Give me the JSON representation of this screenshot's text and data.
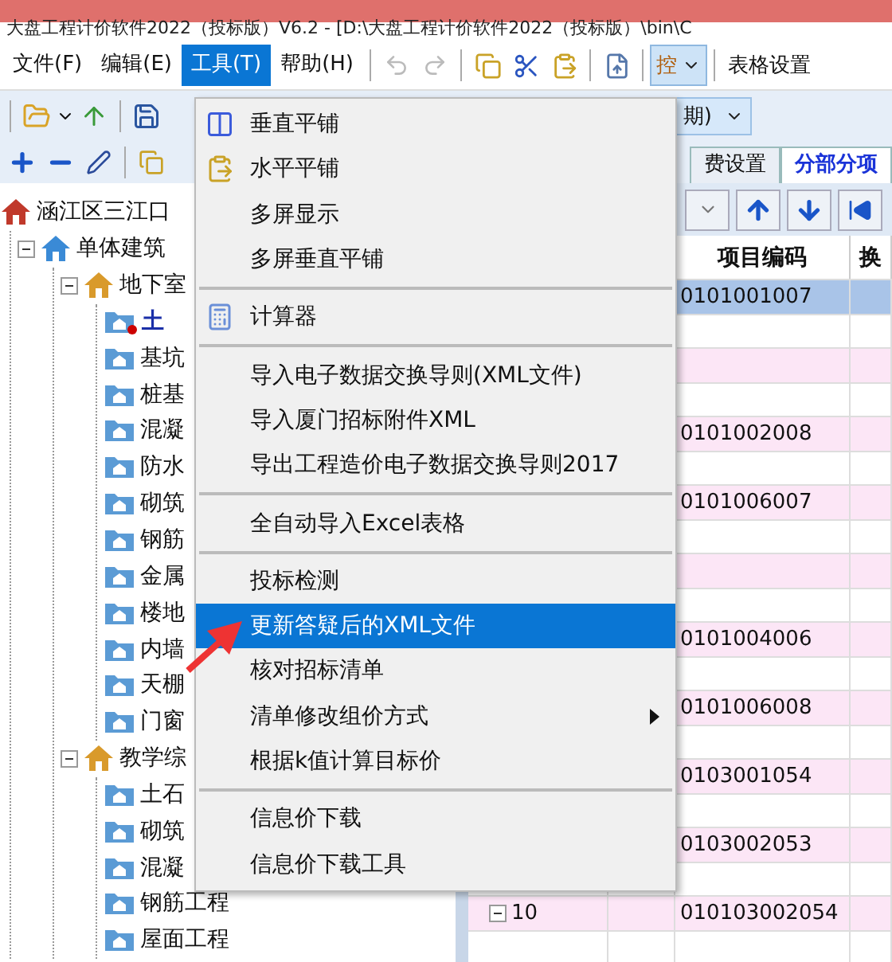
{
  "window": {
    "title": "大盘工程计价软件2022（投标版）V6.2 - [D:\\大盘工程计价软件2022（投标版）\\bin\\C"
  },
  "menubar": [
    {
      "label": "文件(F)",
      "selected": false
    },
    {
      "label": "编辑(E)",
      "selected": false
    },
    {
      "label": "工具(T)",
      "selected": true
    },
    {
      "label": "帮助(H)",
      "selected": false
    }
  ],
  "toolbar": {
    "control_label": "控",
    "table_settings": "表格设置",
    "period_combo": "期)"
  },
  "tabs": [
    {
      "label": "费设置",
      "selected": false
    },
    {
      "label": "分部分项",
      "selected": true
    }
  ],
  "tree": [
    {
      "label": "涵江区三江口",
      "selected": false,
      "children": [
        {
          "label": "单体建筑",
          "expanded": true,
          "selected": false,
          "children": [
            {
              "label": "地下室",
              "expanded": true,
              "selected": false,
              "children": [
                {
                  "label": "土",
                  "selected": true
                },
                {
                  "label": "基坑",
                  "selected": false
                },
                {
                  "label": "桩基",
                  "selected": false
                },
                {
                  "label": "混凝",
                  "selected": false
                },
                {
                  "label": "防水",
                  "selected": false
                },
                {
                  "label": "砌筑",
                  "selected": false
                },
                {
                  "label": "钢筋",
                  "selected": false
                },
                {
                  "label": "金属",
                  "selected": false
                },
                {
                  "label": "楼地",
                  "selected": false
                },
                {
                  "label": "内墙",
                  "selected": false
                },
                {
                  "label": "天棚",
                  "selected": false
                },
                {
                  "label": "门窗",
                  "selected": false
                }
              ]
            },
            {
              "label": "教学综",
              "expanded": true,
              "selected": false,
              "children": [
                {
                  "label": "土石",
                  "selected": false
                },
                {
                  "label": "砌筑",
                  "selected": false
                },
                {
                  "label": "混凝",
                  "selected": false
                },
                {
                  "label": "钢筋工程",
                  "selected": false
                },
                {
                  "label": "屋面工程",
                  "selected": false
                }
              ]
            }
          ]
        }
      ]
    }
  ],
  "grid": {
    "columns": [
      "项目编码",
      "换"
    ],
    "rows": [
      {
        "kind": "item",
        "code": "0101001007",
        "selected": true
      },
      {
        "kind": "detail",
        "selected": false
      },
      {
        "kind": "item",
        "selected": false
      },
      {
        "kind": "detail",
        "selected": false
      },
      {
        "kind": "item",
        "code": "0101002008",
        "selected": false
      },
      {
        "kind": "detail",
        "selected": false
      },
      {
        "kind": "item",
        "code": "0101006007",
        "selected": false
      },
      {
        "kind": "detail",
        "selected": false
      },
      {
        "kind": "item",
        "selected": false
      },
      {
        "kind": "detail",
        "selected": false
      },
      {
        "kind": "item",
        "code": "0101004006",
        "selected": false
      },
      {
        "kind": "detail",
        "selected": false
      },
      {
        "kind": "item",
        "code": "0101006008",
        "selected": false
      },
      {
        "kind": "detail",
        "selected": false
      },
      {
        "kind": "item",
        "code": "0103001054",
        "selected": false
      },
      {
        "kind": "detail",
        "selected": false
      },
      {
        "kind": "item",
        "code": "0103002053",
        "selected": false
      },
      {
        "kind": "detail",
        "selected": false
      },
      {
        "kind": "item",
        "number": "10",
        "expanded": true,
        "code": "010103002054",
        "selected": false
      },
      {
        "kind": "detail",
        "selected": false
      }
    ]
  },
  "menu": [
    {
      "kind": "columns",
      "label": "垂直平铺",
      "selected": false
    },
    {
      "kind": "clipboard",
      "label": "水平平铺",
      "selected": false
    },
    {
      "kind": "plain",
      "label": "多屏显示",
      "selected": false
    },
    {
      "kind": "plain",
      "label": "多屏垂直平铺",
      "selected": false
    },
    {
      "kind": "separator"
    },
    {
      "kind": "calculator",
      "label": "计算器",
      "selected": false
    },
    {
      "kind": "separator"
    },
    {
      "kind": "plain",
      "label": "导入电子数据交换导则(XML文件)",
      "selected": false
    },
    {
      "kind": "plain",
      "label": "导入厦门招标附件XML",
      "selected": false
    },
    {
      "kind": "plain",
      "label": "导出工程造价电子数据交换导则2017",
      "selected": false
    },
    {
      "kind": "separator"
    },
    {
      "kind": "plain",
      "label": "全自动导入Excel表格",
      "selected": false
    },
    {
      "kind": "separator"
    },
    {
      "kind": "plain",
      "label": "投标检测",
      "selected": false
    },
    {
      "kind": "plain",
      "label": "更新答疑后的XML文件",
      "selected": true
    },
    {
      "kind": "plain",
      "label": "核对招标清单",
      "selected": false
    },
    {
      "kind": "submenu",
      "label": "清单修改组价方式",
      "selected": false
    },
    {
      "kind": "plain",
      "label": "根据k值计算目标价",
      "selected": false
    },
    {
      "kind": "separator"
    },
    {
      "kind": "plain",
      "label": "信息价下载",
      "selected": false
    },
    {
      "kind": "plain",
      "label": "信息价下载工具",
      "selected": false
    }
  ]
}
